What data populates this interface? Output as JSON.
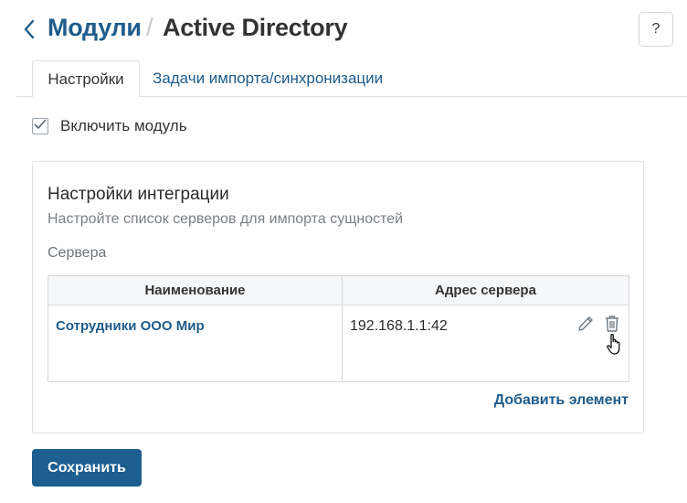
{
  "header": {
    "breadcrumb_link": "Модули",
    "separator": "/",
    "title": "Active Directory",
    "help_label": "?"
  },
  "tabs": [
    {
      "label": "Настройки",
      "active": true
    },
    {
      "label": "Задачи импорта/синхронизации",
      "active": false
    }
  ],
  "enable_module": {
    "label": "Включить модуль",
    "checked": true
  },
  "integration": {
    "title": "Настройки интеграции",
    "subtitle": "Настройте список серверов для импорта сущностей",
    "servers_label": "Сервера",
    "columns": [
      "Наименование",
      "Адрес сервера"
    ],
    "rows": [
      {
        "name": "Сотрудники ООО Мир",
        "address": "192.168.1.1:42"
      }
    ],
    "add_label": "Добавить элемент"
  },
  "save_label": "Сохранить",
  "colors": {
    "accent": "#1f5c8b",
    "button": "#1d5f91",
    "border": "#dde1e5"
  },
  "icons": {
    "back": "chevron-left-icon",
    "help": "question-icon",
    "check": "checkmark-icon",
    "edit": "pencil-icon",
    "delete": "trash-icon",
    "cursor": "hand-cursor-icon"
  }
}
